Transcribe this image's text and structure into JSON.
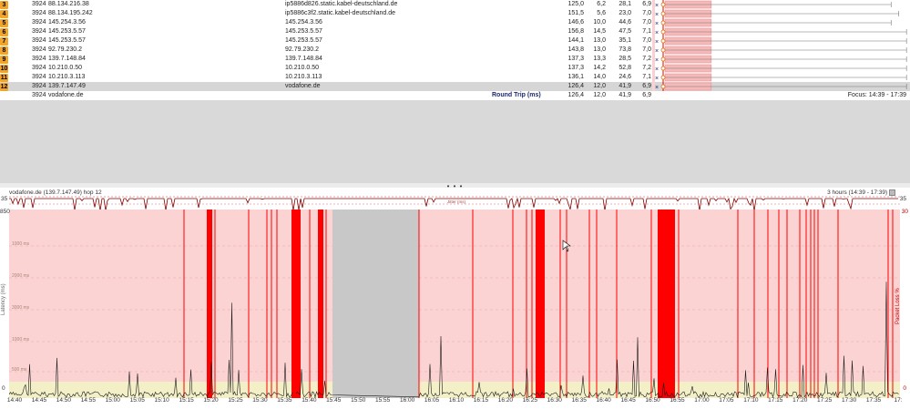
{
  "hops": [
    {
      "num": "3",
      "count": "3924",
      "ip": "88.134.216.38",
      "name": "ip5886d826.static.kabel-deutschland.de",
      "avg": "125,0",
      "min": "6,2",
      "cur": "28,1",
      "pl": "6,9"
    },
    {
      "num": "4",
      "count": "3924",
      "ip": "88.134.195.242",
      "name": "ip5886c3f2.static.kabel-deutschland.de",
      "avg": "151,5",
      "min": "5,6",
      "cur": "23,0",
      "pl": "7,0"
    },
    {
      "num": "5",
      "count": "3924",
      "ip": "145.254.3.56",
      "name": "145.254.3.56",
      "avg": "146,6",
      "min": "10,0",
      "cur": "44,6",
      "pl": "7,0"
    },
    {
      "num": "6",
      "count": "3924",
      "ip": "145.253.5.57",
      "name": "145.253.5.57",
      "avg": "156,8",
      "min": "14,5",
      "cur": "47,5",
      "pl": "7,1"
    },
    {
      "num": "7",
      "count": "3924",
      "ip": "145.253.5.57",
      "name": "145.253.5.57",
      "avg": "144,1",
      "min": "13,0",
      "cur": "35,1",
      "pl": "7,0"
    },
    {
      "num": "8",
      "count": "3924",
      "ip": "92.79.230.2",
      "name": "92.79.230.2",
      "avg": "143,8",
      "min": "13,0",
      "cur": "73,8",
      "pl": "7,0"
    },
    {
      "num": "9",
      "count": "3924",
      "ip": "139.7.148.84",
      "name": "139.7.148.84",
      "avg": "137,3",
      "min": "13,3",
      "cur": "28,5",
      "pl": "7,2"
    },
    {
      "num": "10",
      "count": "3924",
      "ip": "10.210.0.50",
      "name": "10.210.0.50",
      "avg": "137,3",
      "min": "14,2",
      "cur": "52,8",
      "pl": "7,2"
    },
    {
      "num": "11",
      "count": "3924",
      "ip": "10.210.3.113",
      "name": "10.210.3.113",
      "avg": "136,1",
      "min": "14,0",
      "cur": "24,6",
      "pl": "7,1"
    },
    {
      "num": "12",
      "count": "3924",
      "ip": "139.7.147.49",
      "name": "vodafone.de",
      "avg": "126,4",
      "min": "12,0",
      "cur": "41,9",
      "pl": "6,9",
      "selected": true
    }
  ],
  "hop_graph": [
    {
      "bar_end": 0.23,
      "line_end": 0.93
    },
    {
      "bar_end": 0.23,
      "line_end": 0.96
    },
    {
      "bar_end": 0.23,
      "line_end": 0.93
    },
    {
      "bar_end": 0.23,
      "line_end": 0.99
    },
    {
      "bar_end": 0.23,
      "line_end": 0.99
    },
    {
      "bar_end": 0.23,
      "line_end": 0.99
    },
    {
      "bar_end": 0.23,
      "line_end": 0.99
    },
    {
      "bar_end": 0.23,
      "line_end": 0.99
    },
    {
      "bar_end": 0.23,
      "line_end": 0.99
    },
    {
      "bar_end": 0.23,
      "line_end": 0.99
    }
  ],
  "summary": {
    "count": "3924",
    "name": "vodafone.de",
    "label": "Round Trip (ms)",
    "avg": "126,4",
    "min": "12,0",
    "cur": "41,9",
    "pl": "6,9",
    "focus": "Focus: 14:39 - 17:39"
  },
  "splitter_glyph": "• • •",
  "timeline": {
    "title": "vodafone.de (139.7.147.49) hop 12",
    "range": "3 hours (14:39 - 17:39)",
    "y_max_left": "850",
    "y_max_right": "30",
    "y_min_left": "0",
    "y_min_right": "0",
    "jitter_top": "35",
    "jitter_label": "Jitter (ms)",
    "left_axis_label": "Latency (ms)",
    "right_axis_label": "Packet Loss %",
    "y_grid_labels": [
      "1000 ms",
      "2000 ms",
      "3000 ms",
      "1000 ms",
      "500 ms"
    ],
    "x_ticks": [
      "14:40",
      "14:45",
      "14:50",
      "14:55",
      "15:00",
      "15:05",
      "15:10",
      "15:15",
      "15:20",
      "15:25",
      "15:30",
      "15:35",
      "15:40",
      "15:45",
      "15:50",
      "15:55",
      "16:00",
      "16:05",
      "16:10",
      "16:15",
      "16:20",
      "16:25",
      "16:30",
      "16:35",
      "16:40",
      "16:45",
      "16:50",
      "16:55",
      "17:00",
      "17:05",
      "17:10",
      "17:15",
      "17:20",
      "17:25",
      "17:30",
      "17:35",
      "17:"
    ],
    "colors": {
      "loss_bg": "#fcd3d3",
      "good_band": "#f3f0c8",
      "loss_bar": "#ff0000",
      "gap": "#c8c8c8",
      "latency": "#1a1a1a"
    }
  }
}
